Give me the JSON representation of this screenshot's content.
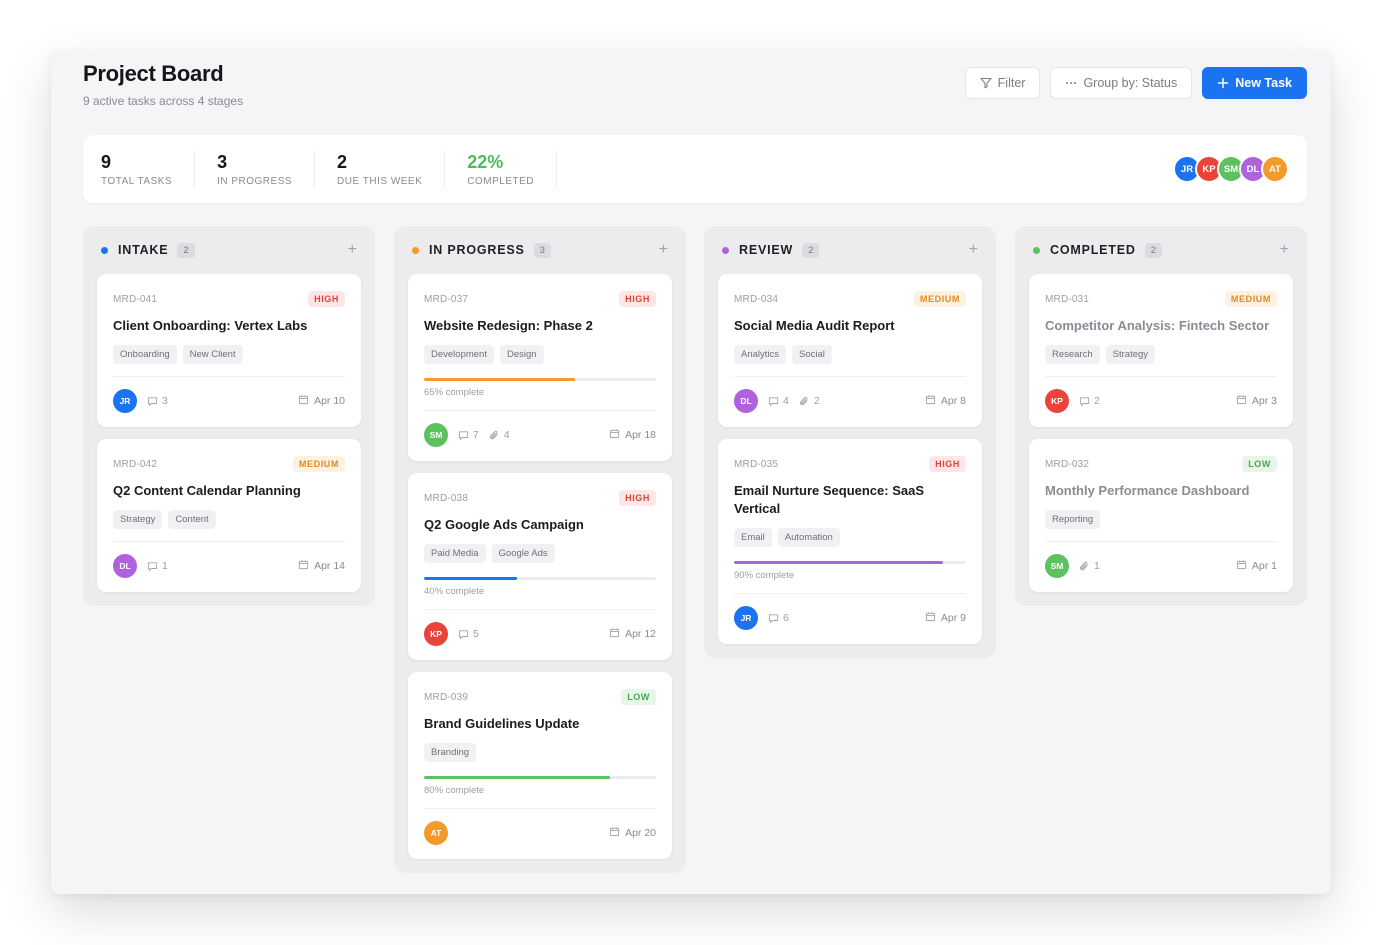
{
  "header": {
    "title": "Project Board",
    "subtitle": "9 active tasks across 4 stages",
    "filter_label": "Filter",
    "group_label": "Group by: Status",
    "new_task_label": "New Task"
  },
  "stats": [
    {
      "value": "9",
      "label": "Total Tasks"
    },
    {
      "value": "3",
      "label": "In Progress"
    },
    {
      "value": "2",
      "label": "Due This Week"
    },
    {
      "value": "22%",
      "label": "Completed"
    }
  ],
  "team": [
    {
      "initials": "JR",
      "color": "#1a73f0"
    },
    {
      "initials": "KP",
      "color": "#e8443a"
    },
    {
      "initials": "SM",
      "color": "#5cc15e"
    },
    {
      "initials": "DL",
      "color": "#b061dc"
    },
    {
      "initials": "AT",
      "color": "#f39a2b"
    }
  ],
  "columns": [
    {
      "title": "INTAKE",
      "count": "2",
      "color": "#1a73f0",
      "cards": [
        {
          "id": "MRD-041",
          "priority": "HIGH",
          "title": "Client Onboarding: Vertex Labs",
          "tags": [
            "Onboarding",
            "New Client"
          ],
          "avatar": "JR",
          "comments": "3",
          "due": "Apr 10"
        },
        {
          "id": "MRD-042",
          "priority": "MEDIUM",
          "title": "Q2 Content Calendar Planning",
          "tags": [
            "Strategy",
            "Content"
          ],
          "avatar": "DL",
          "comments": "1",
          "due": "Apr 14"
        }
      ]
    },
    {
      "title": "IN PROGRESS",
      "count": "3",
      "color": "#f39a2b",
      "cards": [
        {
          "id": "MRD-037",
          "priority": "HIGH",
          "title": "Website Redesign: Phase 2",
          "tags": [
            "Development",
            "Design"
          ],
          "progress": 65,
          "progress_label": "65% complete",
          "progress_color": "#f39a2b",
          "avatar": "SM",
          "comments": "7",
          "attachments": "4",
          "due": "Apr 18"
        },
        {
          "id": "MRD-038",
          "priority": "HIGH",
          "title": "Q2 Google Ads Campaign",
          "tags": [
            "Paid Media",
            "Google Ads"
          ],
          "progress": 40,
          "progress_label": "40% complete",
          "progress_color": "#1a73f0",
          "avatar": "KP",
          "comments": "5",
          "due": "Apr 12"
        },
        {
          "id": "MRD-039",
          "priority": "LOW",
          "title": "Brand Guidelines Update",
          "tags": [
            "Branding"
          ],
          "progress": 80,
          "progress_label": "80% complete",
          "progress_color": "#5cc15e",
          "avatar": "AT",
          "due": "Apr 20"
        }
      ]
    },
    {
      "title": "REVIEW",
      "count": "2",
      "color": "#b061dc",
      "cards": [
        {
          "id": "MRD-034",
          "priority": "MEDIUM",
          "title": "Social Media Audit Report",
          "tags": [
            "Analytics",
            "Social"
          ],
          "avatar": "DL",
          "comments": "4",
          "attachments": "2",
          "due": "Apr 8"
        },
        {
          "id": "MRD-035",
          "priority": "HIGH",
          "title": "Email Nurture Sequence: SaaS Vertical",
          "tags": [
            "Email",
            "Automation"
          ],
          "progress": 90,
          "progress_label": "90% complete",
          "progress_color": "#b061dc",
          "avatar": "JR",
          "comments": "6",
          "due": "Apr 9"
        }
      ]
    },
    {
      "title": "COMPLETED",
      "count": "2",
      "color": "#5cc15e",
      "done": true,
      "cards": [
        {
          "id": "MRD-031",
          "priority": "MEDIUM",
          "title": "Competitor Analysis: Fintech Sector",
          "tags": [
            "Research",
            "Strategy"
          ],
          "avatar": "KP",
          "comments": "2",
          "due": "Apr 3"
        },
        {
          "id": "MRD-032",
          "priority": "LOW",
          "title": "Monthly Performance Dashboard",
          "tags": [
            "Reporting"
          ],
          "avatar": "SM",
          "attachments": "1",
          "due": "Apr 1"
        }
      ]
    }
  ]
}
